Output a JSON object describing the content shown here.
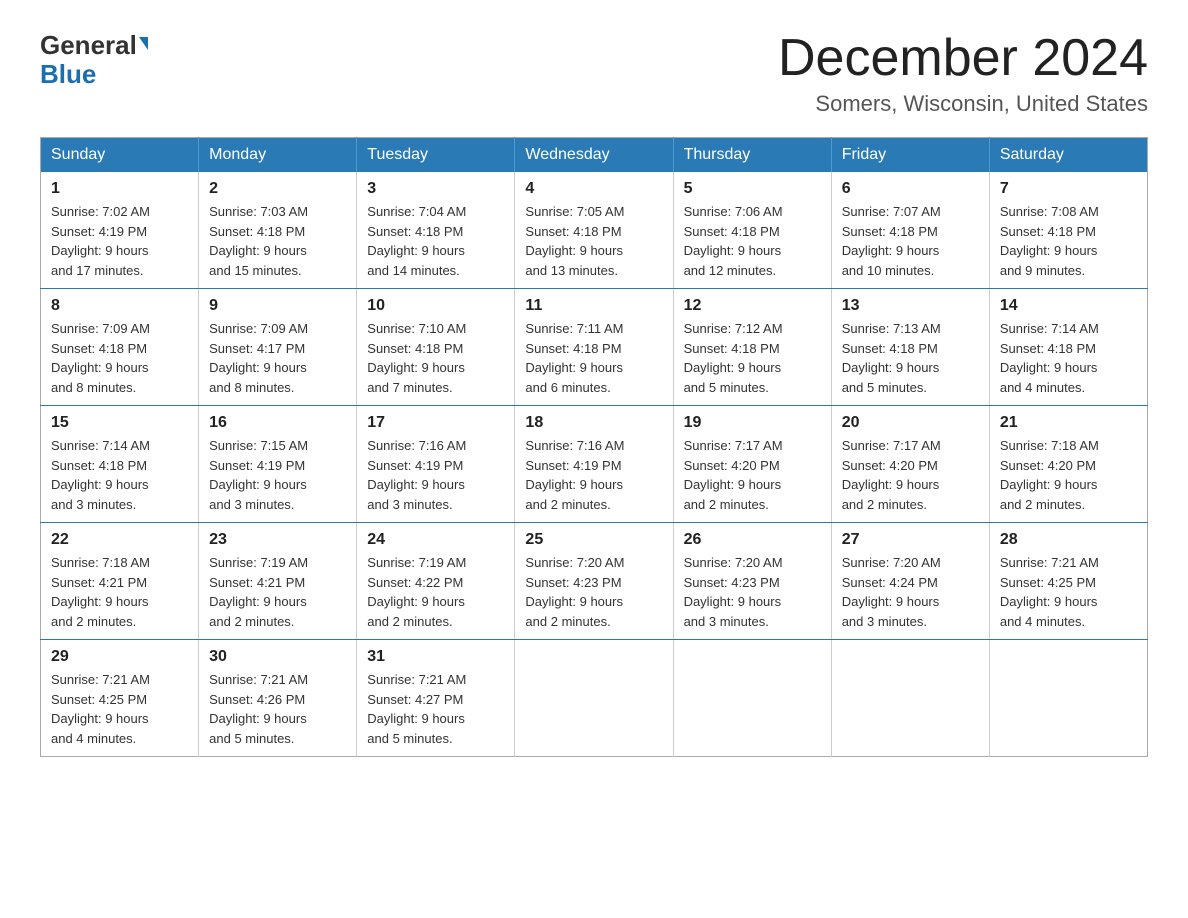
{
  "header": {
    "logo_general": "General",
    "logo_blue": "Blue",
    "month_year": "December 2024",
    "location": "Somers, Wisconsin, United States"
  },
  "weekdays": [
    "Sunday",
    "Monday",
    "Tuesday",
    "Wednesday",
    "Thursday",
    "Friday",
    "Saturday"
  ],
  "weeks": [
    [
      {
        "day": "1",
        "sunrise": "7:02 AM",
        "sunset": "4:19 PM",
        "daylight": "9 hours and 17 minutes."
      },
      {
        "day": "2",
        "sunrise": "7:03 AM",
        "sunset": "4:18 PM",
        "daylight": "9 hours and 15 minutes."
      },
      {
        "day": "3",
        "sunrise": "7:04 AM",
        "sunset": "4:18 PM",
        "daylight": "9 hours and 14 minutes."
      },
      {
        "day": "4",
        "sunrise": "7:05 AM",
        "sunset": "4:18 PM",
        "daylight": "9 hours and 13 minutes."
      },
      {
        "day": "5",
        "sunrise": "7:06 AM",
        "sunset": "4:18 PM",
        "daylight": "9 hours and 12 minutes."
      },
      {
        "day": "6",
        "sunrise": "7:07 AM",
        "sunset": "4:18 PM",
        "daylight": "9 hours and 10 minutes."
      },
      {
        "day": "7",
        "sunrise": "7:08 AM",
        "sunset": "4:18 PM",
        "daylight": "9 hours and 9 minutes."
      }
    ],
    [
      {
        "day": "8",
        "sunrise": "7:09 AM",
        "sunset": "4:18 PM",
        "daylight": "9 hours and 8 minutes."
      },
      {
        "day": "9",
        "sunrise": "7:09 AM",
        "sunset": "4:17 PM",
        "daylight": "9 hours and 8 minutes."
      },
      {
        "day": "10",
        "sunrise": "7:10 AM",
        "sunset": "4:18 PM",
        "daylight": "9 hours and 7 minutes."
      },
      {
        "day": "11",
        "sunrise": "7:11 AM",
        "sunset": "4:18 PM",
        "daylight": "9 hours and 6 minutes."
      },
      {
        "day": "12",
        "sunrise": "7:12 AM",
        "sunset": "4:18 PM",
        "daylight": "9 hours and 5 minutes."
      },
      {
        "day": "13",
        "sunrise": "7:13 AM",
        "sunset": "4:18 PM",
        "daylight": "9 hours and 5 minutes."
      },
      {
        "day": "14",
        "sunrise": "7:14 AM",
        "sunset": "4:18 PM",
        "daylight": "9 hours and 4 minutes."
      }
    ],
    [
      {
        "day": "15",
        "sunrise": "7:14 AM",
        "sunset": "4:18 PM",
        "daylight": "9 hours and 3 minutes."
      },
      {
        "day": "16",
        "sunrise": "7:15 AM",
        "sunset": "4:19 PM",
        "daylight": "9 hours and 3 minutes."
      },
      {
        "day": "17",
        "sunrise": "7:16 AM",
        "sunset": "4:19 PM",
        "daylight": "9 hours and 3 minutes."
      },
      {
        "day": "18",
        "sunrise": "7:16 AM",
        "sunset": "4:19 PM",
        "daylight": "9 hours and 2 minutes."
      },
      {
        "day": "19",
        "sunrise": "7:17 AM",
        "sunset": "4:20 PM",
        "daylight": "9 hours and 2 minutes."
      },
      {
        "day": "20",
        "sunrise": "7:17 AM",
        "sunset": "4:20 PM",
        "daylight": "9 hours and 2 minutes."
      },
      {
        "day": "21",
        "sunrise": "7:18 AM",
        "sunset": "4:20 PM",
        "daylight": "9 hours and 2 minutes."
      }
    ],
    [
      {
        "day": "22",
        "sunrise": "7:18 AM",
        "sunset": "4:21 PM",
        "daylight": "9 hours and 2 minutes."
      },
      {
        "day": "23",
        "sunrise": "7:19 AM",
        "sunset": "4:21 PM",
        "daylight": "9 hours and 2 minutes."
      },
      {
        "day": "24",
        "sunrise": "7:19 AM",
        "sunset": "4:22 PM",
        "daylight": "9 hours and 2 minutes."
      },
      {
        "day": "25",
        "sunrise": "7:20 AM",
        "sunset": "4:23 PM",
        "daylight": "9 hours and 2 minutes."
      },
      {
        "day": "26",
        "sunrise": "7:20 AM",
        "sunset": "4:23 PM",
        "daylight": "9 hours and 3 minutes."
      },
      {
        "day": "27",
        "sunrise": "7:20 AM",
        "sunset": "4:24 PM",
        "daylight": "9 hours and 3 minutes."
      },
      {
        "day": "28",
        "sunrise": "7:21 AM",
        "sunset": "4:25 PM",
        "daylight": "9 hours and 4 minutes."
      }
    ],
    [
      {
        "day": "29",
        "sunrise": "7:21 AM",
        "sunset": "4:25 PM",
        "daylight": "9 hours and 4 minutes."
      },
      {
        "day": "30",
        "sunrise": "7:21 AM",
        "sunset": "4:26 PM",
        "daylight": "9 hours and 5 minutes."
      },
      {
        "day": "31",
        "sunrise": "7:21 AM",
        "sunset": "4:27 PM",
        "daylight": "9 hours and 5 minutes."
      },
      null,
      null,
      null,
      null
    ]
  ]
}
